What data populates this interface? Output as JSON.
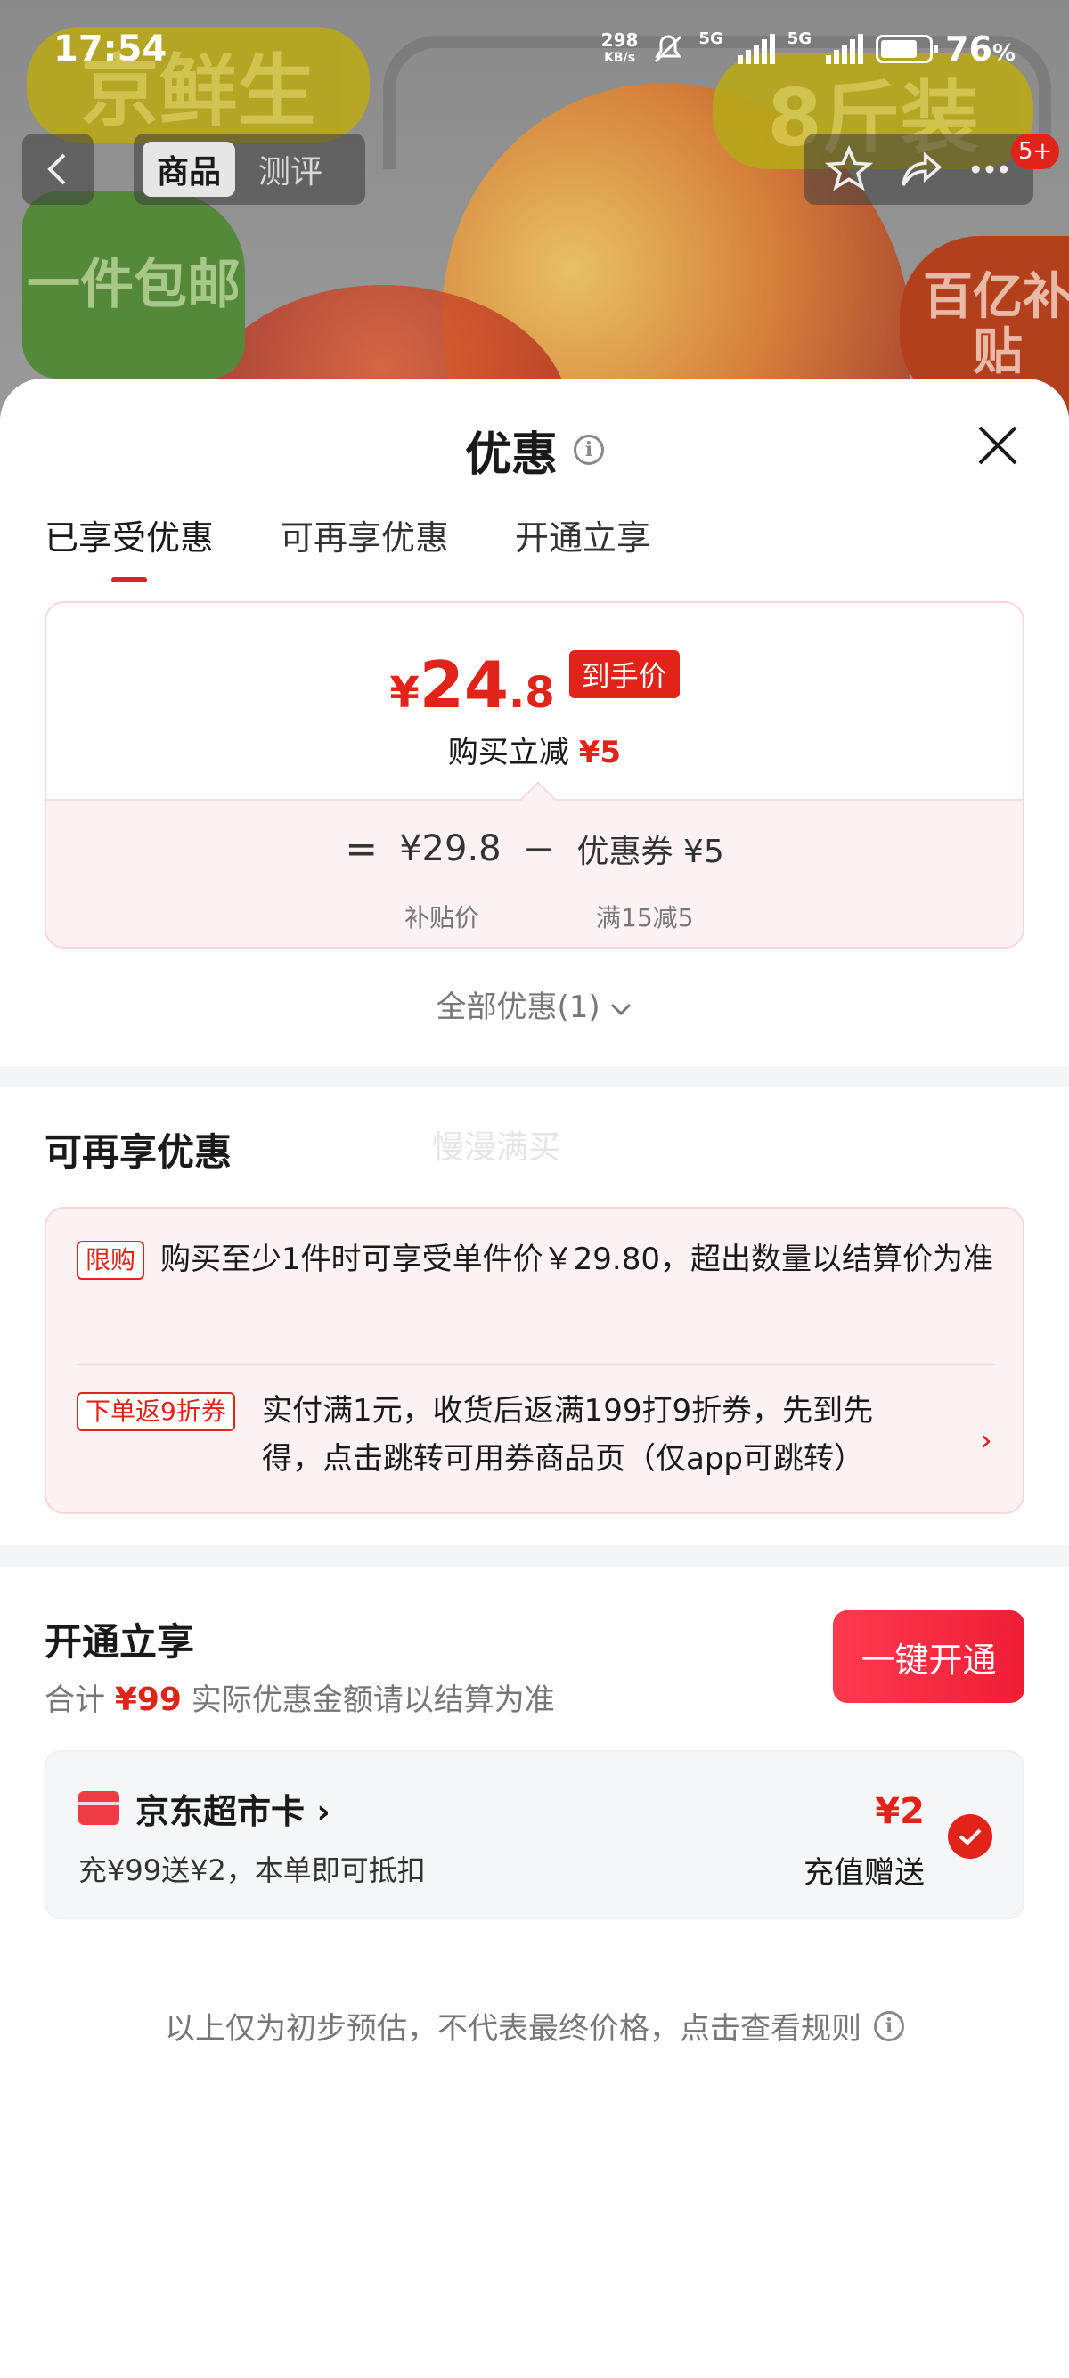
{
  "status_bar": {
    "time": "17:54",
    "net_speed_value": "298",
    "net_speed_unit": "KB/s",
    "signal1_label": "5G",
    "signal2_label": "5G",
    "battery_percent": "76",
    "battery_level": 0.76
  },
  "background": {
    "badge_brand": "京鲜生",
    "badge_weight": "8斤装",
    "badge_free": "一件包邮",
    "badge_subsidy": "百亿补贴"
  },
  "nav": {
    "tabs": [
      {
        "label": "商品",
        "active": true
      },
      {
        "label": "测评",
        "active": false
      }
    ],
    "message_count": "5+"
  },
  "sheet": {
    "title": "优惠",
    "tabs": [
      {
        "label": "已享受优惠",
        "active": true
      },
      {
        "label": "可再享优惠",
        "active": false
      },
      {
        "label": "开通立享",
        "active": false
      }
    ],
    "price": {
      "currency": "¥",
      "integer": "24",
      "decimal": ".8",
      "tag": "到手价",
      "instant_label": "购买立减",
      "instant_value": "¥5",
      "eq": "=",
      "subsidy_price": "¥29.8",
      "minus": "−",
      "coupon": "优惠券 ¥5",
      "subsidy_label": "补贴价",
      "coupon_rule": "满15减5"
    },
    "all_discount": "全部优惠(1)",
    "more_section": {
      "title": "可再享优惠",
      "watermark": "慢漫满买",
      "items": [
        {
          "tag": "限购",
          "text": "购买至少1件时可享受单件价￥29.80，超出数量以结算价为准"
        },
        {
          "tag": "下单返9折券",
          "text": "实付满1元，收货后返满199打9折券，先到先得，点击跳转可用券商品页（仅app可跳转）"
        }
      ]
    },
    "open_section": {
      "title": "开通立享",
      "total_label": "合计",
      "total_value": "¥99",
      "total_note": "实际优惠金额请以结算为准",
      "button": "一键开通",
      "card": {
        "name": "京东超市卡",
        "desc": "充¥99送¥2，本单即可抵扣",
        "amount": "¥2",
        "gift": "充值赠送",
        "checked": true
      }
    },
    "footer_note": "以上仅为初步预估，不代表最终价格，点击查看规则"
  },
  "colors": {
    "accent": "#e2231a",
    "button_gradient_start": "#ff3a4e",
    "button_gradient_end": "#ee1e35",
    "muted_text": "#777777"
  },
  "icons": [
    "back-arrow-icon",
    "star-icon",
    "share-icon",
    "more-icon",
    "info-icon",
    "close-icon",
    "chevron-down-icon",
    "chevron-right-icon",
    "card-icon",
    "check-icon"
  ]
}
